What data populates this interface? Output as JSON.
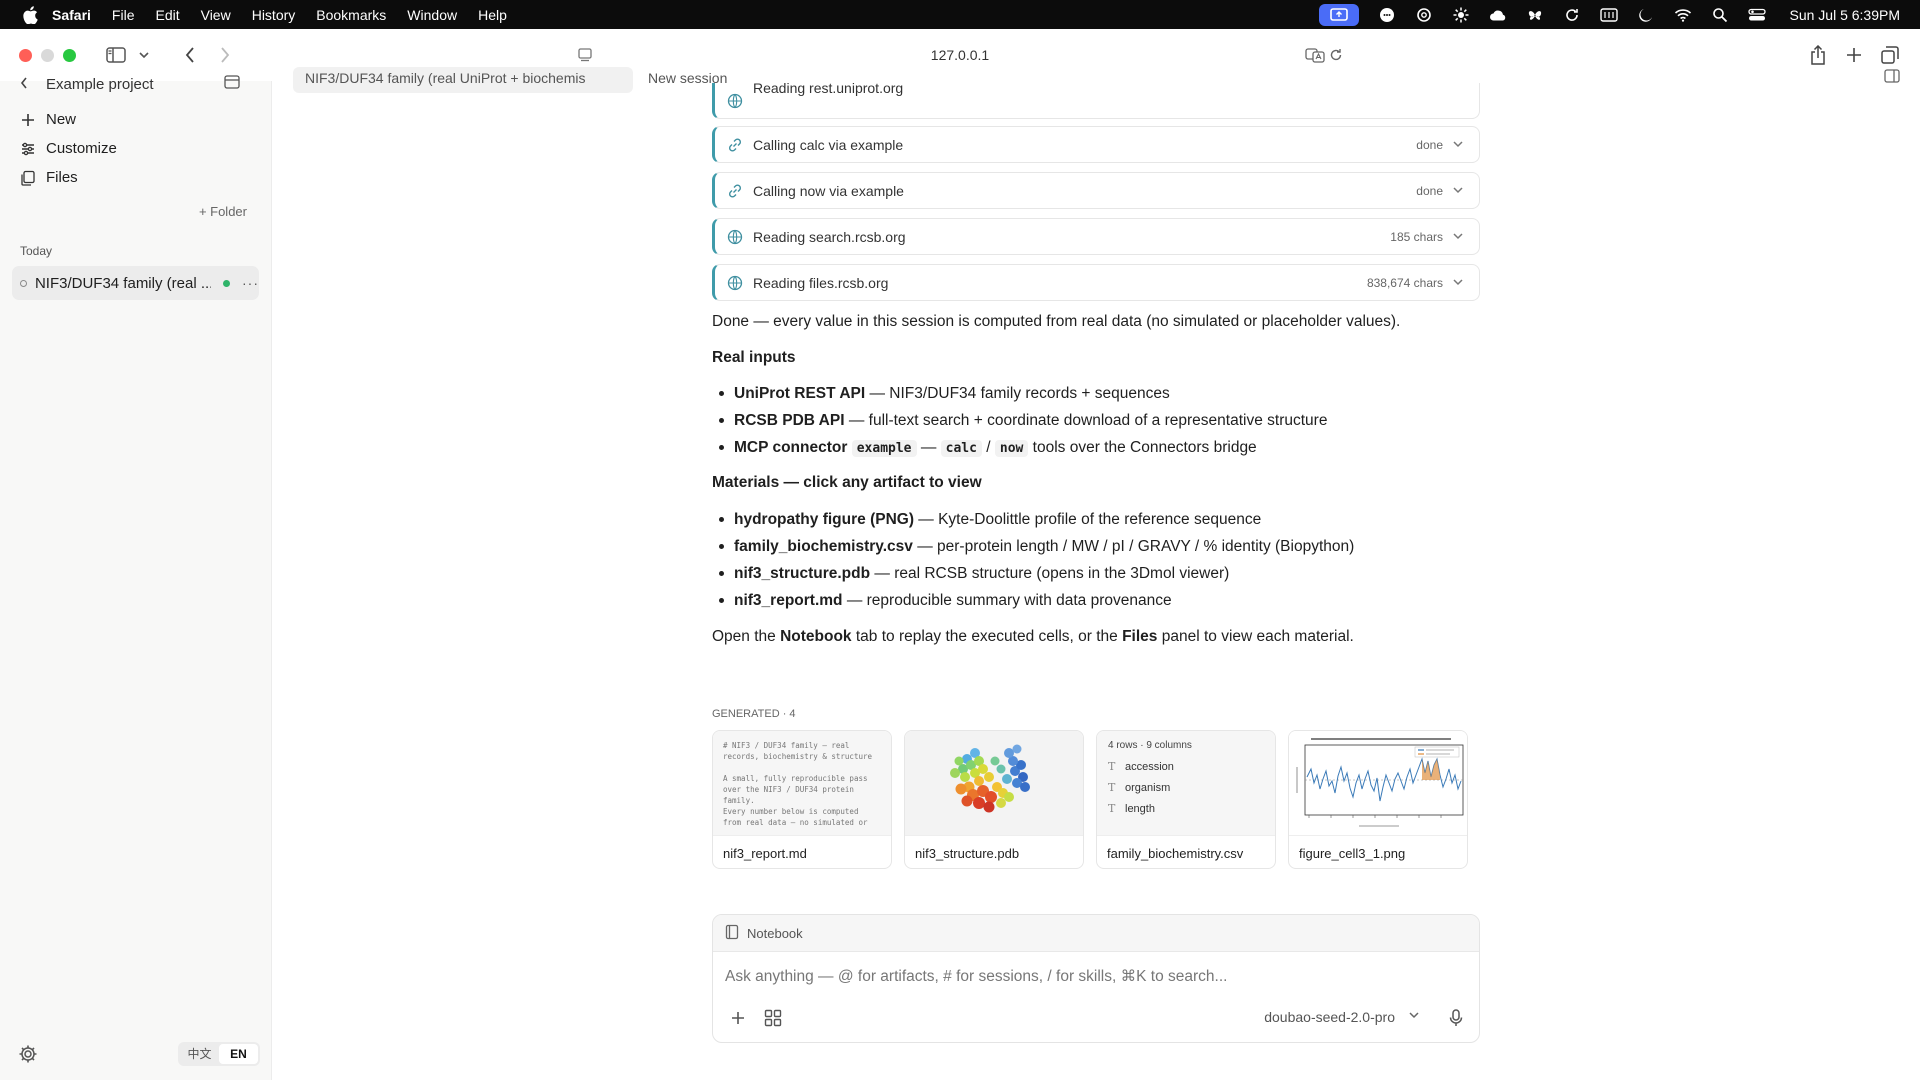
{
  "menubar": {
    "app": "Safari",
    "items": [
      "File",
      "Edit",
      "View",
      "History",
      "Bookmarks",
      "Window",
      "Help"
    ],
    "clock": "Sun Jul 5  6:39PM"
  },
  "browser": {
    "url": "127.0.0.1"
  },
  "sidebar": {
    "project": "Example project",
    "new_label": "New",
    "customize_label": "Customize",
    "files_label": "Files",
    "folder_label": "+ Folder",
    "section_today": "Today",
    "session_title": "NIF3/DUF34 family (real ...",
    "lang_zh": "中文",
    "lang_en": "EN"
  },
  "tabs": {
    "active": "NIF3/DUF34 family (real UniProt + biochemis",
    "new_session": "New session"
  },
  "tool_calls": [
    {
      "label": "Reading rest.uniprot.org",
      "status": "",
      "icon": "globe-icon"
    },
    {
      "label": "Calling calc via example",
      "status": "done",
      "icon": "link-icon"
    },
    {
      "label": "Calling now via example",
      "status": "done",
      "icon": "link-icon"
    },
    {
      "label": "Reading search.rcsb.org",
      "status": "185 chars",
      "icon": "globe-icon"
    },
    {
      "label": "Reading files.rcsb.org",
      "status": "838,674 chars",
      "icon": "globe-icon"
    }
  ],
  "message": {
    "done_text": "Done — every value in this session is computed from real data (no simulated or placeholder values).",
    "real_inputs_heading": "Real inputs",
    "inputs": [
      {
        "name": "UniProt REST API",
        "desc": " — NIF3/DUF34 family records + sequences"
      },
      {
        "name": "RCSB PDB API",
        "desc": " — full-text search + coordinate download of a representative structure"
      },
      {
        "name": "MCP connector",
        "code1": "example",
        "sep1": " — ",
        "code2": "calc",
        "sep2": " / ",
        "code3": "now",
        "desc": " tools over the Connectors bridge"
      }
    ],
    "materials_heading": "Materials — click any artifact to view",
    "materials": [
      {
        "name": "hydropathy figure (PNG)",
        "desc": " — Kyte-Doolittle profile of the reference sequence"
      },
      {
        "name": "family_biochemistry.csv",
        "desc": " — per-protein length / MW / pI / GRAVY / % identity (Biopython)"
      },
      {
        "name": "nif3_structure.pdb",
        "desc": " — real RCSB structure (opens in the 3Dmol viewer)"
      },
      {
        "name": "nif3_report.md",
        "desc": " — reproducible summary with data provenance"
      }
    ],
    "closing_pre": "Open the ",
    "closing_b1": "Notebook",
    "closing_mid": " tab to replay the executed cells, or the ",
    "closing_b2": "Files",
    "closing_post": " panel to view each material."
  },
  "generated": {
    "label": "GENERATED · 4",
    "cards": [
      {
        "name": "nif3_report.md",
        "preview": "# NIF3 / DUF34 family — real\nrecords, biochemistry & structure\n\nA small, fully reproducible pass\nover the NIF3 / DUF34 protein\nfamily.\nEvery number below is computed\nfrom real data — no simulated or"
      },
      {
        "name": "nif3_structure.pdb"
      },
      {
        "name": "family_biochemistry.csv",
        "meta": "4 rows · 9 columns",
        "columns": [
          "accession",
          "organism",
          "length"
        ]
      },
      {
        "name": "figure_cell3_1.png"
      }
    ]
  },
  "composer": {
    "notebook_label": "Notebook",
    "placeholder": "Ask anything — @ for artifacts, # for sessions, / for skills, ⌘K to search...",
    "model": "doubao-seed-2.0-pro"
  }
}
